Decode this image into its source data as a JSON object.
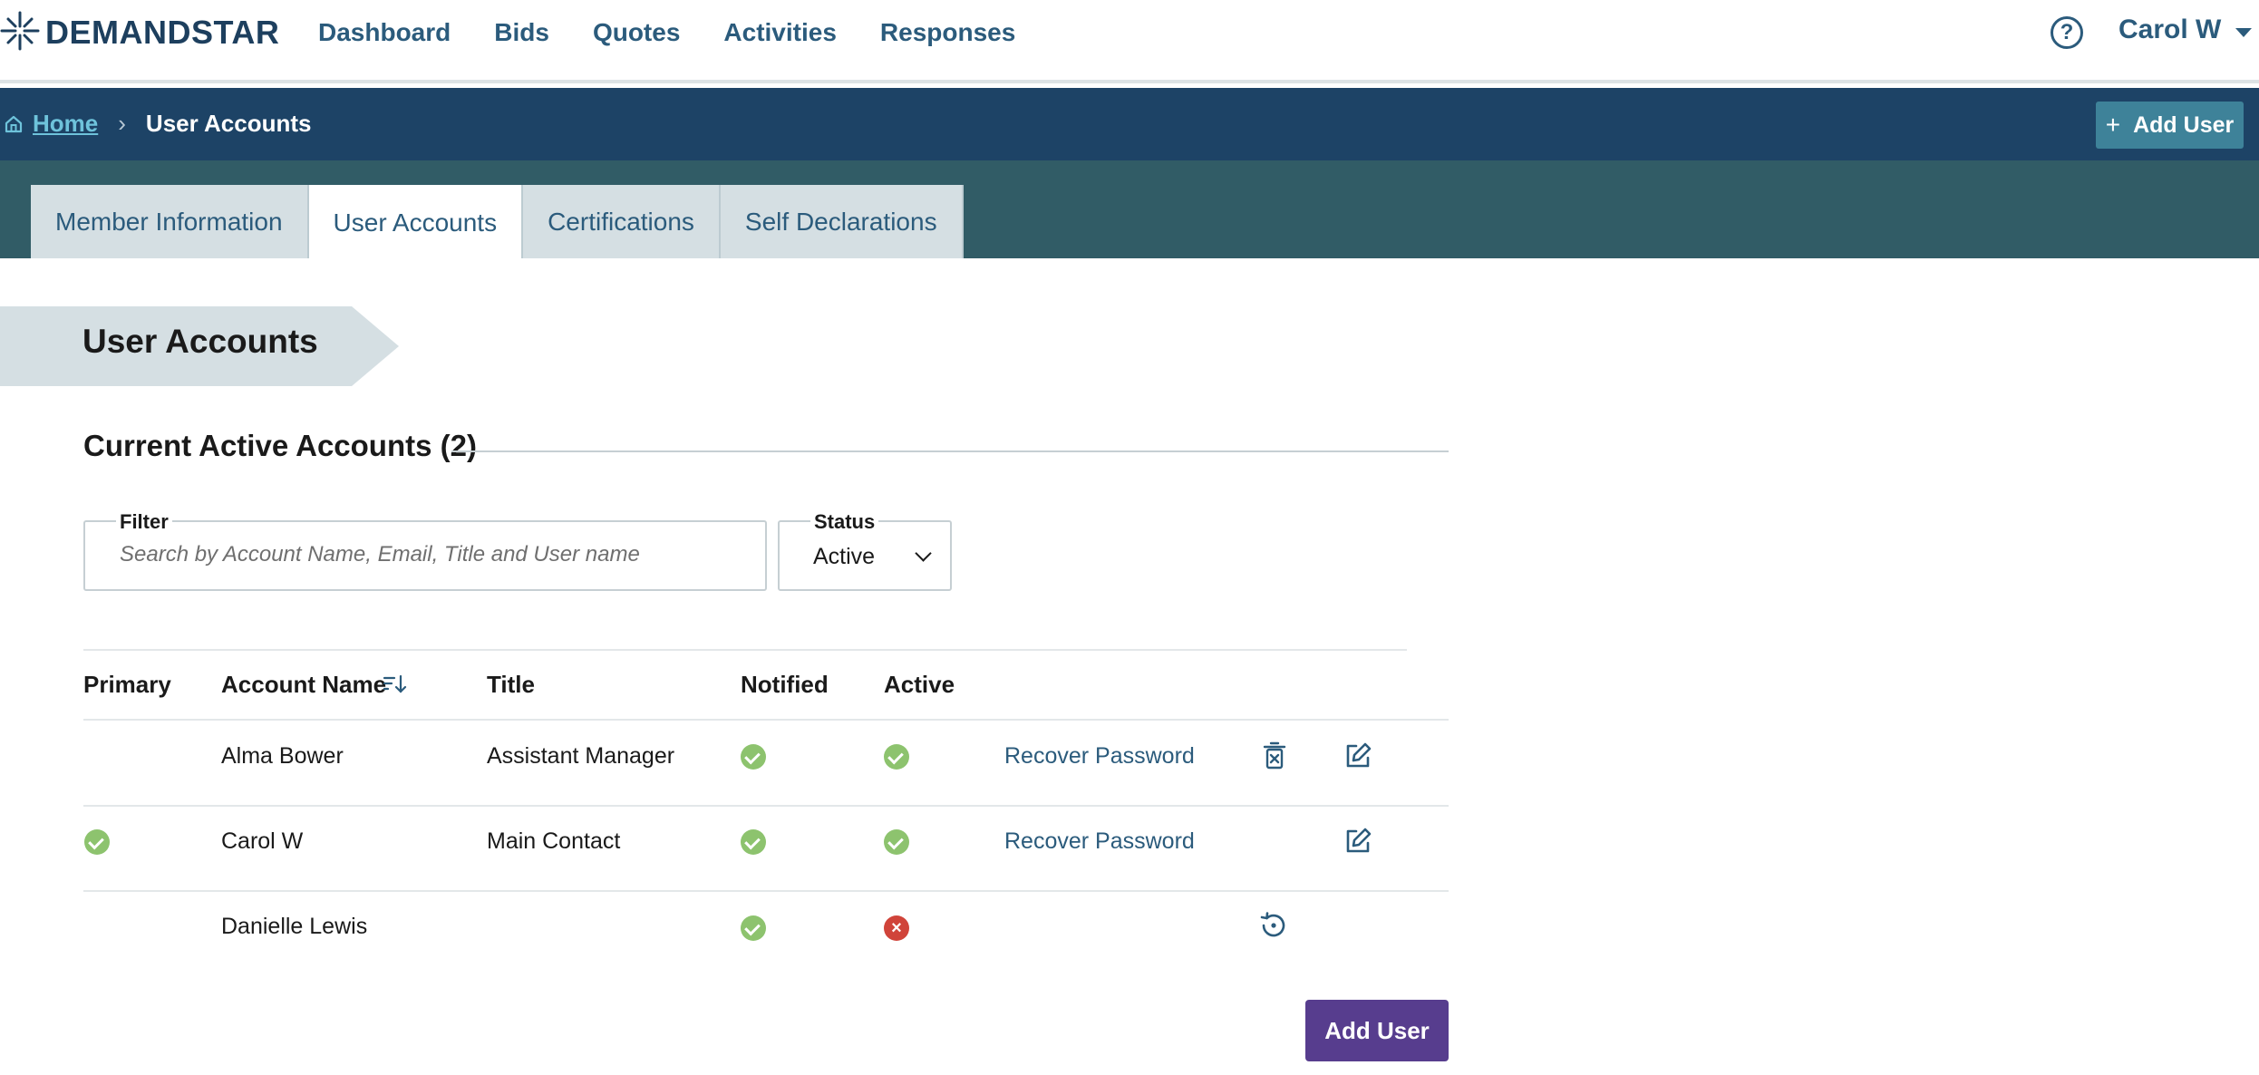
{
  "app": {
    "brand": "DEMANDSTAR",
    "nav": [
      {
        "label": "Dashboard"
      },
      {
        "label": "Bids"
      },
      {
        "label": "Quotes"
      },
      {
        "label": "Activities"
      },
      {
        "label": "Responses"
      }
    ],
    "help_glyph": "?",
    "user_name": "Carol W"
  },
  "breadcrumb": {
    "home": "Home",
    "separator": "›",
    "current": "User Accounts"
  },
  "header_action": {
    "plus": "+",
    "label": "Add User"
  },
  "tabs": [
    {
      "label": "Member Information",
      "active": false
    },
    {
      "label": "User Accounts",
      "active": true
    },
    {
      "label": "Certifications",
      "active": false
    },
    {
      "label": "Self Declarations",
      "active": false
    }
  ],
  "page": {
    "title": "User Accounts",
    "section_title": "Current Active Accounts (2)"
  },
  "filter": {
    "label": "Filter",
    "placeholder": "Search by Account Name, Email, Title and User name",
    "value": ""
  },
  "status": {
    "label": "Status",
    "selected": "Active"
  },
  "table": {
    "columns": [
      "Primary",
      "Account Name",
      "Title",
      "Notified",
      "Active"
    ],
    "rows": [
      {
        "primary": false,
        "name": "Alma Bower",
        "title": "Assistant Manager",
        "notified": true,
        "active": true,
        "link": "Recover Password",
        "actions": [
          "delete",
          "edit"
        ]
      },
      {
        "primary": true,
        "name": "Carol W",
        "title": "Main Contact",
        "notified": true,
        "active": true,
        "link": "Recover Password",
        "actions": [
          "edit"
        ]
      },
      {
        "primary": false,
        "name": "Danielle Lewis",
        "title": "",
        "notified": true,
        "active": false,
        "link": "",
        "actions": [
          "restore"
        ]
      }
    ]
  },
  "inactive_glyph": "×",
  "footer_action": {
    "label": "Add User"
  },
  "colors": {
    "navy": "#1d4366",
    "teal_band": "#315c66",
    "link": "#2b5b7c",
    "success": "#8dc36e",
    "danger": "#d0443a",
    "primary_button": "#573d8e",
    "secondary_button": "#3e8299"
  },
  "icons": {
    "logo": "star-burst-icon",
    "help": "question-circle-icon",
    "user_caret": "caret-down-icon",
    "home": "home-icon",
    "sort": "sort-descending-icon",
    "delete": "trash-icon",
    "edit": "edit-icon",
    "restore": "restore-icon",
    "status_ok": "check-circle-icon",
    "status_no": "x-circle-icon"
  }
}
